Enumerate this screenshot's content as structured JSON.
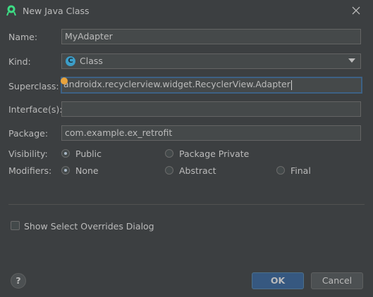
{
  "window": {
    "title": "New Java Class",
    "icon": "android-studio-icon",
    "close_icon": "close-icon"
  },
  "form": {
    "name": {
      "label": "Name:",
      "value": "MyAdapter"
    },
    "kind": {
      "label": "Kind:",
      "value": "Class",
      "badge": "C",
      "badge_color": "#3c9ec8"
    },
    "superclass": {
      "label": "Superclass:",
      "value": "androidx.recyclerview.widget.RecyclerView.Adapter"
    },
    "interfaces": {
      "label": "Interface(s):",
      "value": ""
    },
    "package": {
      "label": "Package:",
      "value": "com.example.ex_retrofit"
    },
    "visibility": {
      "label": "Visibility:",
      "options": [
        {
          "label": "Public",
          "checked": true
        },
        {
          "label": "Package Private",
          "checked": false
        }
      ]
    },
    "modifiers": {
      "label": "Modifiers:",
      "options": [
        {
          "label": "None",
          "checked": true
        },
        {
          "label": "Abstract",
          "checked": false
        },
        {
          "label": "Final",
          "checked": false
        }
      ]
    }
  },
  "options": {
    "show_overrides": {
      "label": "Show Select Overrides Dialog",
      "checked": false
    }
  },
  "buttons": {
    "help": "?",
    "ok": "OK",
    "cancel": "Cancel"
  },
  "colors": {
    "background": "#3c3f41",
    "field_bg": "#45494a",
    "focus_border": "#3d6185",
    "ok_button": "#365880",
    "hint_dot": "#e8a33d"
  }
}
